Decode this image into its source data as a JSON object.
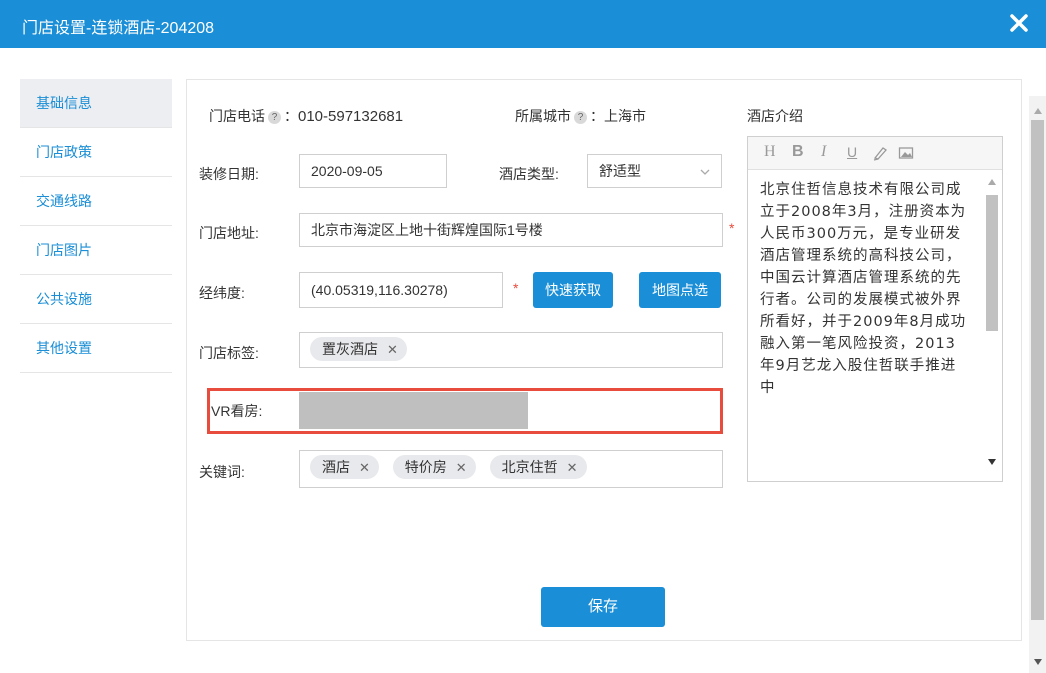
{
  "dialog": {
    "title": "门店设置-连锁酒店-204208"
  },
  "sidebar": {
    "items": [
      {
        "label": "基础信息"
      },
      {
        "label": "门店政策"
      },
      {
        "label": "交通线路"
      },
      {
        "label": "门店图片"
      },
      {
        "label": "公共设施"
      },
      {
        "label": "其他设置"
      }
    ]
  },
  "form": {
    "phone_label": "门店电话",
    "phone_value": "010-597132681",
    "city_label": "所属城市",
    "city_value": "上海市",
    "help_glyph": "?",
    "colon": "：",
    "renovation_label": "装修日期:",
    "renovation_value": "2020-09-05",
    "hotel_type_label": "酒店类型:",
    "hotel_type_value": "舒适型",
    "address_label": "门店地址:",
    "address_value": "北京市海淀区上地十街辉煌国际1号楼",
    "coords_label": "经纬度:",
    "coords_value": "(40.05319,116.30278)",
    "required_mark": "*",
    "quick_fetch_button": "快速获取",
    "map_select_button": "地图点选",
    "tags_label": "门店标签:",
    "tags": [
      "置灰酒店"
    ],
    "vr_label": "VR看房:",
    "keywords_label": "关键词:",
    "keywords": [
      "酒店",
      "特价房",
      "北京住哲"
    ],
    "remove_glyph": "✕",
    "save_button": "保存"
  },
  "intro": {
    "label": "酒店介绍",
    "toolbar": {
      "heading": "H",
      "bold": "B",
      "italic": "I",
      "underline": "U"
    },
    "text": "北京住哲信息技术有限公司成立于2008年3月，注册资本为人民币300万元，是专业研发酒店管理系统的高科技公司，中国云计算酒店管理系统的先行者。公司的发展模式被外界所看好，并于2009年8月成功融入第一笔风险投资，2013年9月艺龙入股住哲联手推进中"
  }
}
